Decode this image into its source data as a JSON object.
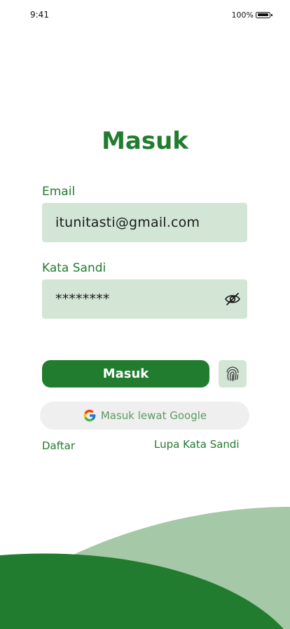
{
  "status_bar": {
    "time": "9:41",
    "battery_percent": "100%",
    "battery_level": 1.0,
    "battery_icon": "battery-full-icon"
  },
  "title": "Masuk",
  "email": {
    "label": "Email",
    "value": "itunitasti@gmail.com"
  },
  "password": {
    "label": "Kata Sandi",
    "value": "********",
    "toggle_icon": "eye-off-icon"
  },
  "login_button_label": "Masuk",
  "fingerprint_icon": "fingerprint-icon",
  "google_button": {
    "label": "Masuk lewat Google",
    "icon": "google-logo-icon"
  },
  "links": {
    "register": "Daftar",
    "forgot_password": "Lupa Kata Sandi"
  },
  "colors": {
    "primary": "#217c2f",
    "field_bg": "#d3e6d6",
    "google_bg": "#efefef",
    "google_text": "#5c9b62",
    "wave_light": "#a5c8a7",
    "wave_dark": "#217c2f"
  }
}
